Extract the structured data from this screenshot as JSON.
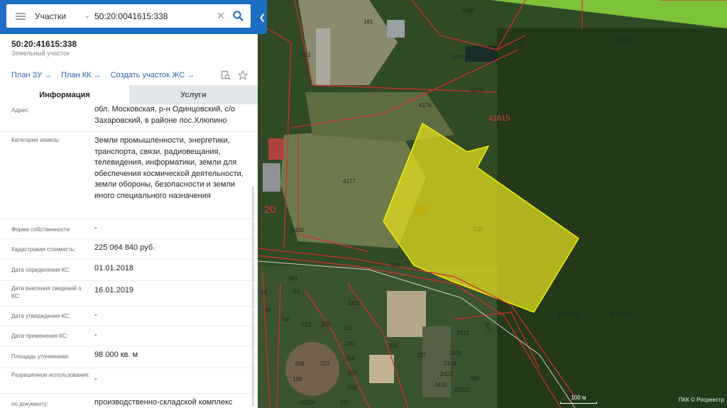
{
  "search": {
    "layer": "Участки",
    "query": "50:20:0041615:338"
  },
  "object": {
    "title": "50:20:41615:338",
    "type": "Земельный участок"
  },
  "links": [
    {
      "label": "План ЗУ",
      "arrow": "→"
    },
    {
      "label": "План КК",
      "arrow": "→"
    },
    {
      "label": "Создать участок ЖС",
      "arrow": "→"
    }
  ],
  "tabs": {
    "info": "Информация",
    "services": "Услуги"
  },
  "fields": [
    {
      "label": "Адрес:",
      "value": "обл. Московская, р-н Одинцовский, с/о Захаровский, в районе пос.Хлюпино"
    },
    {
      "label": "Категория земель:",
      "value": "Земли промышленности, энергетики, транспорта, связи, радиовещания, телевидения, информатики, земли для обеспечения космической деятельности, земли обороны, безопасности и земли иного специального назначения"
    },
    {
      "label": "Форма собственности:",
      "value": "-"
    },
    {
      "label": "Кадастровая стоимость:",
      "value": "225 064 840 руб."
    },
    {
      "label": "Дата определения КС:",
      "value": "01.01.2018"
    },
    {
      "label": "Дата внесения сведений о КС:",
      "value": "16.01.2019"
    },
    {
      "label": "Дата утверждения КС:",
      "value": "-"
    },
    {
      "label": "Дата применения КС:",
      "value": "-"
    },
    {
      "label": "Площадь уточненная:",
      "value": "98 000 кв. м"
    },
    {
      "label": "Разрешенное использование:",
      "value": "-"
    },
    {
      "label": "по документу:",
      "value": "производственно-складской комплекс"
    }
  ],
  "map": {
    "zone_label": "50",
    "quarter_label": "41615",
    "parcel_label": "338",
    "district_label": "20",
    "parcel_labels": [
      "1448",
      "181",
      "1451",
      "1449",
      "1455",
      "307290",
      "4175",
      "4176",
      "4177",
      "1450",
      "530",
      "313",
      "307323/1",
      "307323/1",
      "161",
      "61",
      "34",
      "3311",
      "635",
      "287",
      "2412",
      "2415",
      "2416",
      "2423",
      "2418",
      "396",
      "202",
      "200",
      "208",
      "207",
      "204",
      "197",
      "209",
      "203",
      "198",
      "60206",
      "60221",
      "338",
      "339",
      "212",
      "205",
      "58",
      "55",
      "44"
    ],
    "scale_label": "100 м",
    "attribution": "ПКК © Росреестр",
    "highlight_color": "#e6e21e"
  }
}
